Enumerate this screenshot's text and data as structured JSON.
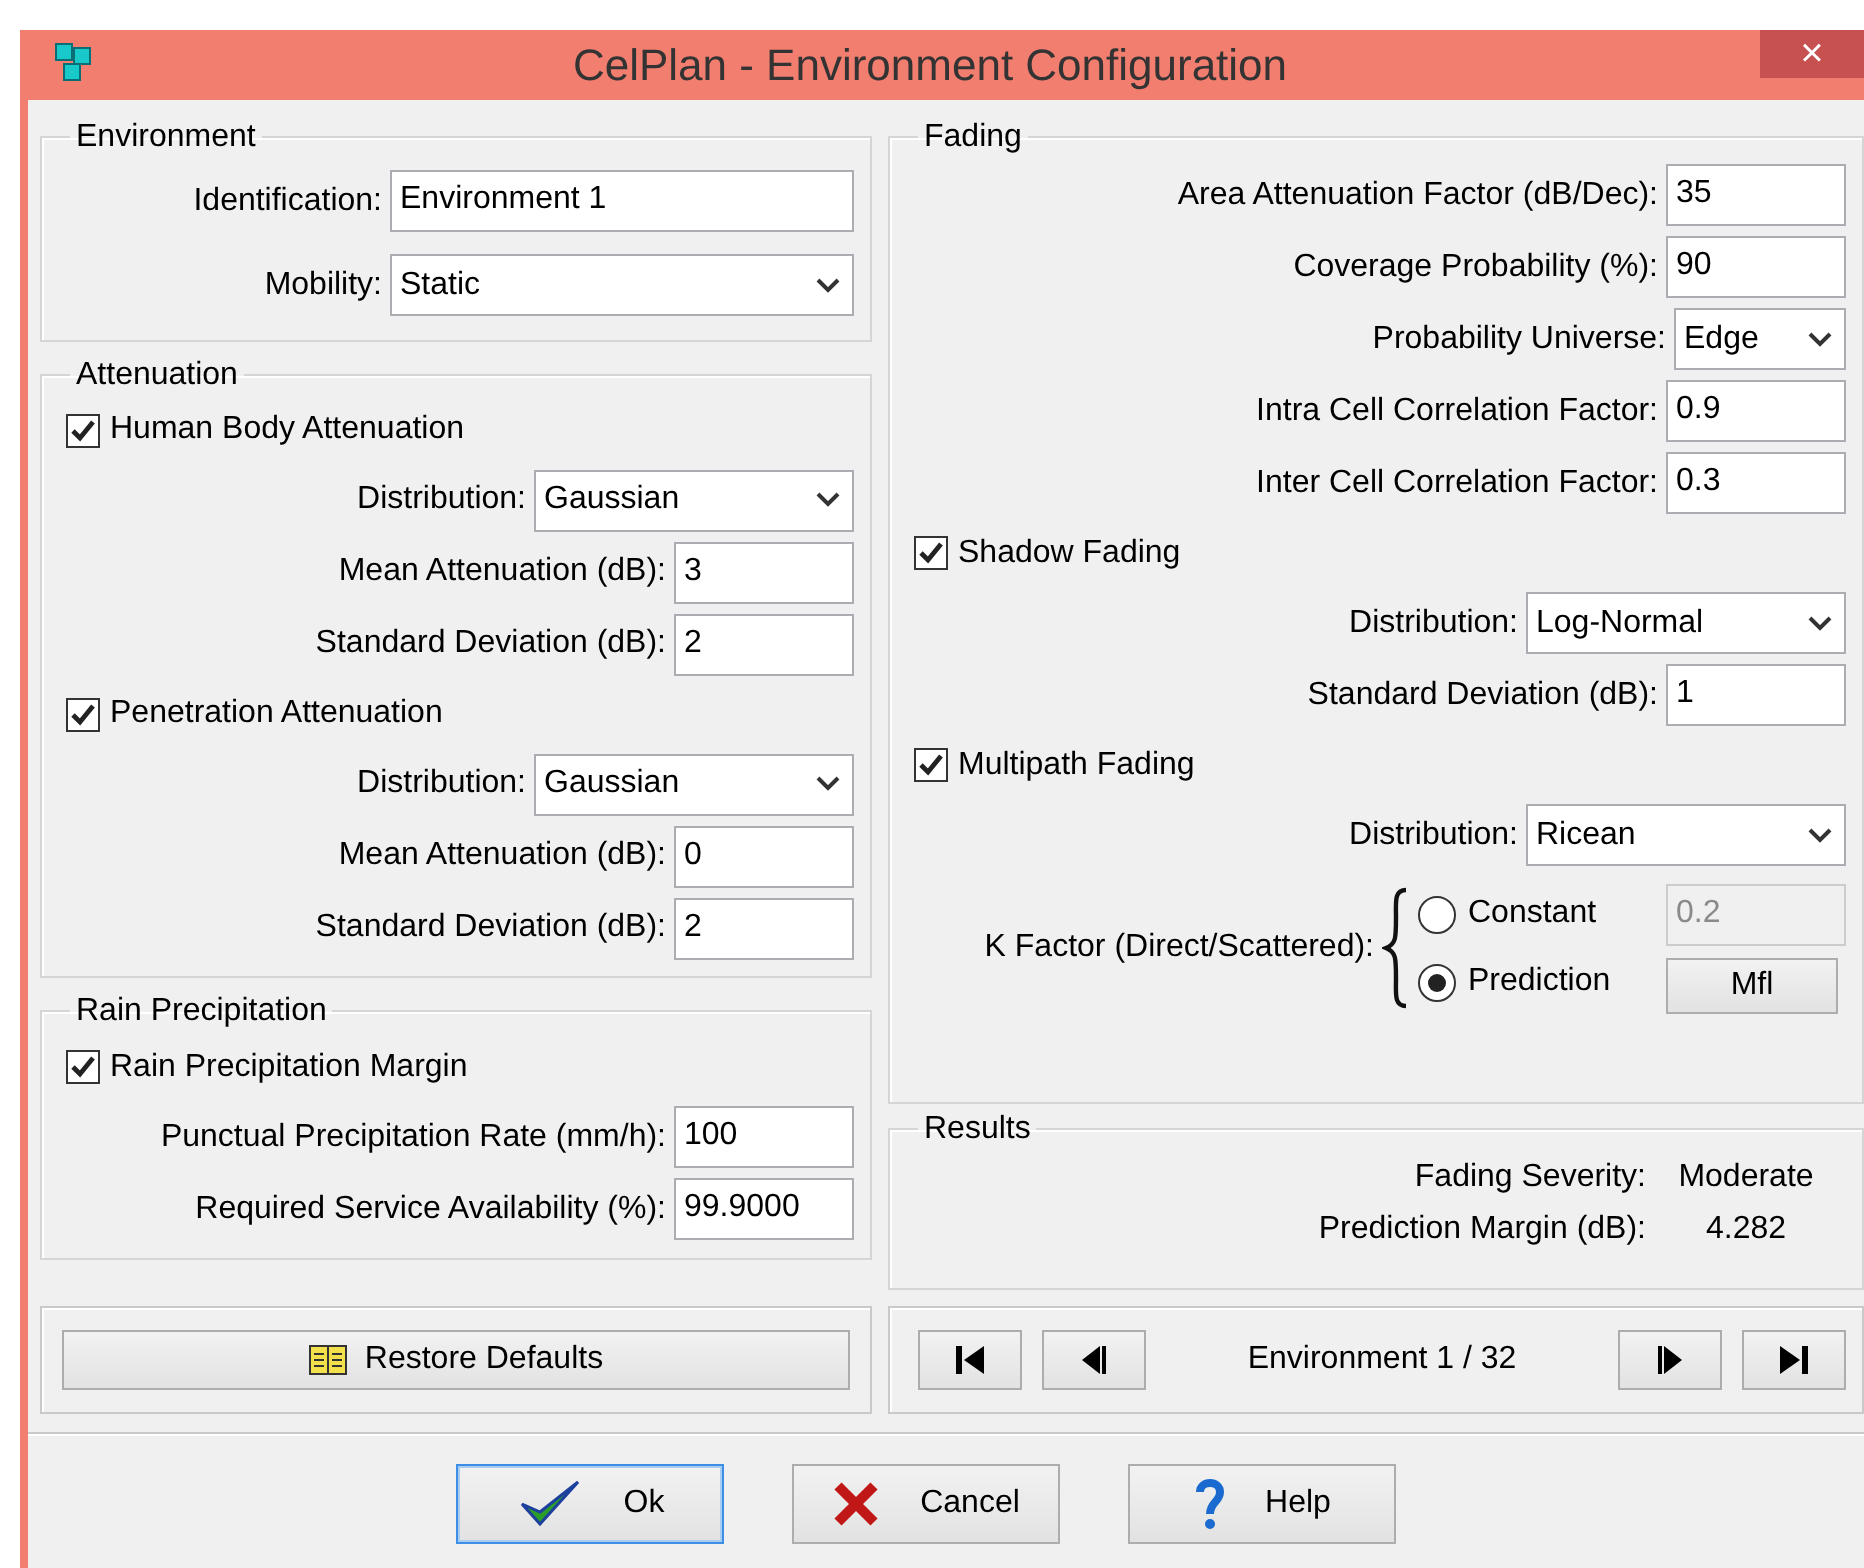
{
  "window": {
    "title": "CelPlan - Environment Configuration",
    "close": "×"
  },
  "environment": {
    "title": "Environment",
    "fields": [
      {
        "kind": "text",
        "label": "Identification:",
        "value": "Environment 1"
      },
      {
        "kind": "select",
        "label": "Mobility:",
        "value": "Static"
      }
    ]
  },
  "attenuation": {
    "title": "Attenuation",
    "groups": [
      {
        "label": "Human Body Attenuation",
        "checked": true,
        "fields": [
          {
            "kind": "select",
            "label": "Distribution:",
            "value": "Gaussian"
          },
          {
            "kind": "text",
            "label": "Mean Attenuation (dB):",
            "value": "3"
          },
          {
            "kind": "text",
            "label": "Standard Deviation (dB):",
            "value": "2"
          }
        ]
      },
      {
        "label": "Penetration Attenuation",
        "checked": true,
        "fields": [
          {
            "kind": "select",
            "label": "Distribution:",
            "value": "Gaussian"
          },
          {
            "kind": "text",
            "label": "Mean Attenuation (dB):",
            "value": "0"
          },
          {
            "kind": "text",
            "label": "Standard Deviation (dB):",
            "value": "2"
          }
        ]
      }
    ]
  },
  "rain": {
    "title": "Rain Precipitation",
    "groups": [
      {
        "label": "Rain Precipitation Margin",
        "checked": true,
        "fields": [
          {
            "kind": "text",
            "label": "Punctual Precipitation Rate (mm/h):",
            "value": "100"
          },
          {
            "kind": "text",
            "label": "Required Service Availability (%):",
            "value": "99.9000"
          }
        ]
      }
    ]
  },
  "fading": {
    "title": "Fading",
    "fields": [
      {
        "kind": "text",
        "label": "Area Attenuation Factor (dB/Dec):",
        "value": "35"
      },
      {
        "kind": "text",
        "label": "Coverage Probability (%):",
        "value": "90"
      },
      {
        "kind": "short-select",
        "label": "Probability Universe:",
        "value": "Edge"
      },
      {
        "kind": "text",
        "label": "Intra Cell Correlation Factor:",
        "value": "0.9"
      },
      {
        "kind": "text",
        "label": "Inter Cell Correlation Factor:",
        "value": "0.3"
      }
    ],
    "groups": [
      {
        "label": "Shadow Fading",
        "checked": true,
        "fields": [
          {
            "kind": "select",
            "label": "Distribution:",
            "value": "Log-Normal"
          },
          {
            "kind": "text",
            "label": "Standard Deviation (dB):",
            "value": "1"
          }
        ]
      },
      {
        "label": "Multipath Fading",
        "checked": true,
        "fields": [
          {
            "kind": "select",
            "label": "Distribution:",
            "value": "Ricean"
          }
        ]
      }
    ],
    "k_factor": {
      "label": "K Factor (Direct/Scattered):",
      "options": [
        {
          "label": "Constant",
          "selected": false
        },
        {
          "label": "Prediction",
          "selected": true
        }
      ],
      "constant_value": "0.2",
      "constant_disabled": true,
      "button": "Mfl"
    }
  },
  "results": {
    "title": "Results",
    "rows": [
      {
        "label": "Fading Severity:",
        "value": "Moderate"
      },
      {
        "label": "Prediction Margin (dB):",
        "value": "4.282"
      }
    ]
  },
  "restore_button": "Restore Defaults",
  "navigator": {
    "label": "Environment 1 / 32"
  },
  "buttons": [
    {
      "kind": "ok",
      "label": "Ok",
      "default": true
    },
    {
      "kind": "cancel",
      "label": "Cancel",
      "default": false
    },
    {
      "kind": "help",
      "label": "Help",
      "default": false
    }
  ]
}
